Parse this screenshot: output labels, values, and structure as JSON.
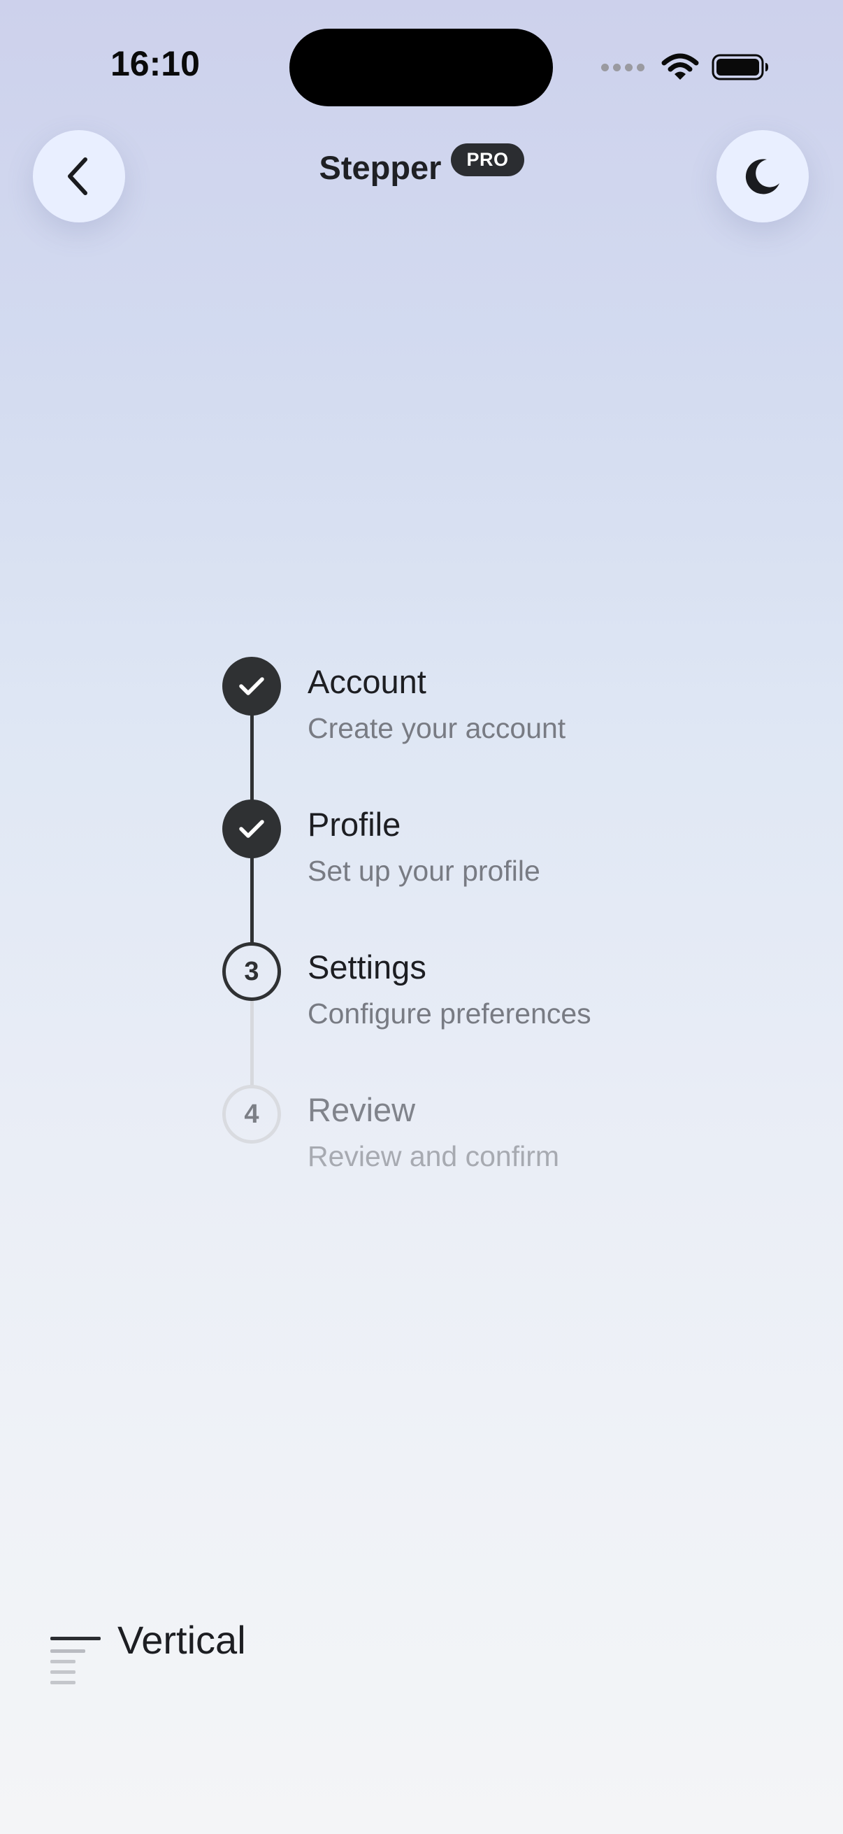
{
  "status_bar": {
    "time": "16:10",
    "icons": [
      "signal-dots-icon",
      "wifi-icon",
      "battery-icon"
    ]
  },
  "header": {
    "title": "Stepper",
    "badge": "PRO",
    "back_icon": "chevron-left-icon",
    "theme_icon": "moon-icon"
  },
  "stepper": {
    "steps": [
      {
        "title": "Account",
        "subtitle": "Create your account",
        "state": "completed",
        "marker": "check-icon"
      },
      {
        "title": "Profile",
        "subtitle": "Set up your profile",
        "state": "completed",
        "marker": "check-icon"
      },
      {
        "title": "Settings",
        "subtitle": "Configure preferences",
        "state": "current",
        "number": "3"
      },
      {
        "title": "Review",
        "subtitle": "Review and confirm",
        "state": "upcoming",
        "number": "4"
      }
    ]
  },
  "variant": {
    "label": "Vertical",
    "icon": "vertical-layout-icon"
  },
  "colors": {
    "accent_dark": "#2f3133",
    "inactive_line": "#d7d9de",
    "button_bg": "#e9efff"
  }
}
